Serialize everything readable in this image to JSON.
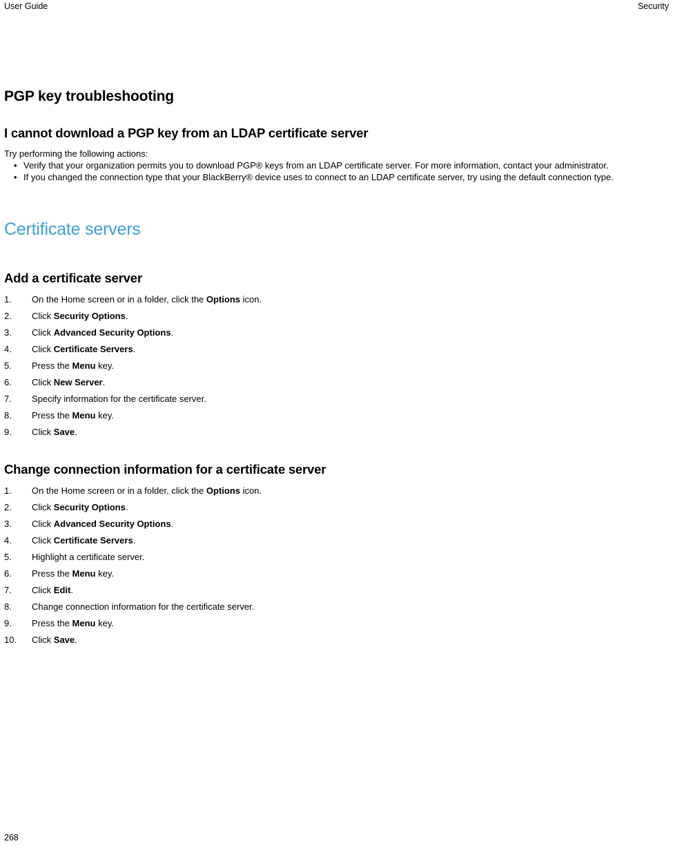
{
  "header": {
    "left": "User Guide",
    "right": "Security"
  },
  "footer": {
    "page_number": "268"
  },
  "colors": {
    "heading_blue": "#3c9fd8",
    "text": "#000000"
  },
  "content": {
    "section_title": "PGP key troubleshooting",
    "topic1": {
      "title": "I cannot download a PGP key from an LDAP certificate server",
      "intro": "Try performing the following actions:",
      "bullets": [
        "Verify that your organization permits you to download PGP® keys from an LDAP certificate server. For more information, contact your administrator.",
        "If you changed the connection type that your BlackBerry® device uses to connect to an LDAP certificate server, try using the default connection type."
      ]
    },
    "blue_heading": "Certificate servers",
    "topic2": {
      "title": "Add a certificate server",
      "steps": [
        {
          "num": "1.",
          "parts": [
            {
              "t": "On the Home screen or in a folder, click the ",
              "b": false
            },
            {
              "t": "Options",
              "b": true
            },
            {
              "t": " icon.",
              "b": false
            }
          ]
        },
        {
          "num": "2.",
          "parts": [
            {
              "t": "Click ",
              "b": false
            },
            {
              "t": "Security Options",
              "b": true
            },
            {
              "t": ".",
              "b": false
            }
          ]
        },
        {
          "num": "3.",
          "parts": [
            {
              "t": "Click ",
              "b": false
            },
            {
              "t": "Advanced Security Options",
              "b": true
            },
            {
              "t": ".",
              "b": false
            }
          ]
        },
        {
          "num": "4.",
          "parts": [
            {
              "t": "Click ",
              "b": false
            },
            {
              "t": "Certificate Servers",
              "b": true
            },
            {
              "t": ".",
              "b": false
            }
          ]
        },
        {
          "num": "5.",
          "parts": [
            {
              "t": "Press the ",
              "b": false
            },
            {
              "t": "Menu",
              "b": true
            },
            {
              "t": " key.",
              "b": false
            }
          ]
        },
        {
          "num": "6.",
          "parts": [
            {
              "t": "Click ",
              "b": false
            },
            {
              "t": "New Server",
              "b": true
            },
            {
              "t": ".",
              "b": false
            }
          ]
        },
        {
          "num": "7.",
          "parts": [
            {
              "t": "Specify information for the certificate server.",
              "b": false
            }
          ]
        },
        {
          "num": "8.",
          "parts": [
            {
              "t": "Press the ",
              "b": false
            },
            {
              "t": "Menu",
              "b": true
            },
            {
              "t": " key.",
              "b": false
            }
          ]
        },
        {
          "num": "9.",
          "parts": [
            {
              "t": "Click ",
              "b": false
            },
            {
              "t": "Save",
              "b": true
            },
            {
              "t": ".",
              "b": false
            }
          ]
        }
      ]
    },
    "topic3": {
      "title": "Change connection information for a certificate server",
      "steps": [
        {
          "num": "1.",
          "parts": [
            {
              "t": "On the Home screen or in a folder, click the ",
              "b": false
            },
            {
              "t": "Options",
              "b": true
            },
            {
              "t": " icon.",
              "b": false
            }
          ]
        },
        {
          "num": "2.",
          "parts": [
            {
              "t": "Click ",
              "b": false
            },
            {
              "t": "Security Options",
              "b": true
            },
            {
              "t": ".",
              "b": false
            }
          ]
        },
        {
          "num": "3.",
          "parts": [
            {
              "t": "Click ",
              "b": false
            },
            {
              "t": "Advanced Security Options",
              "b": true
            },
            {
              "t": ".",
              "b": false
            }
          ]
        },
        {
          "num": "4.",
          "parts": [
            {
              "t": "Click ",
              "b": false
            },
            {
              "t": "Certificate Servers",
              "b": true
            },
            {
              "t": ".",
              "b": false
            }
          ]
        },
        {
          "num": "5.",
          "parts": [
            {
              "t": "Highlight a certificate server.",
              "b": false
            }
          ]
        },
        {
          "num": "6.",
          "parts": [
            {
              "t": "Press the ",
              "b": false
            },
            {
              "t": "Menu",
              "b": true
            },
            {
              "t": " key.",
              "b": false
            }
          ]
        },
        {
          "num": "7.",
          "parts": [
            {
              "t": "Click ",
              "b": false
            },
            {
              "t": "Edit",
              "b": true
            },
            {
              "t": ".",
              "b": false
            }
          ]
        },
        {
          "num": "8.",
          "parts": [
            {
              "t": "Change connection information for the certificate server.",
              "b": false
            }
          ]
        },
        {
          "num": "9.",
          "parts": [
            {
              "t": "Press the ",
              "b": false
            },
            {
              "t": "Menu",
              "b": true
            },
            {
              "t": " key.",
              "b": false
            }
          ]
        },
        {
          "num": "10.",
          "parts": [
            {
              "t": "Click ",
              "b": false
            },
            {
              "t": "Save",
              "b": true
            },
            {
              "t": ".",
              "b": false
            }
          ]
        }
      ]
    },
    "bullet_glyph": "•"
  }
}
